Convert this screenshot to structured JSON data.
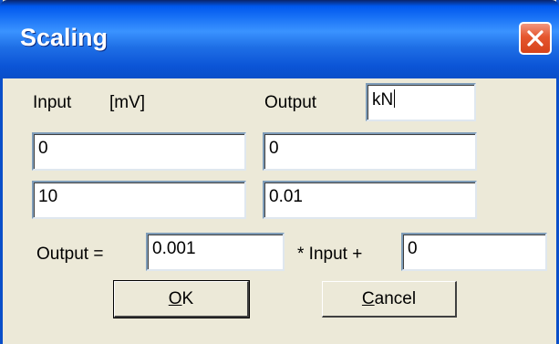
{
  "window": {
    "title": "Scaling"
  },
  "labels": {
    "input": "Input",
    "input_unit": "[mV]",
    "output": "Output",
    "output_eq": "Output =",
    "times_input_plus": "* Input +"
  },
  "fields": {
    "output_unit": "kN",
    "input_low": "0",
    "output_low": "0",
    "input_high": "10",
    "output_high": "0.01",
    "factor": "0.001",
    "offset": "0"
  },
  "buttons": {
    "ok_mnemonic": "O",
    "ok_rest": "K",
    "cancel_mnemonic": "C",
    "cancel_rest": "ancel"
  },
  "colors": {
    "titlebar": "#0a4fc9",
    "client_bg": "#ece9d8",
    "close_button": "#e5562e"
  },
  "icons": {
    "close": "close-icon"
  }
}
